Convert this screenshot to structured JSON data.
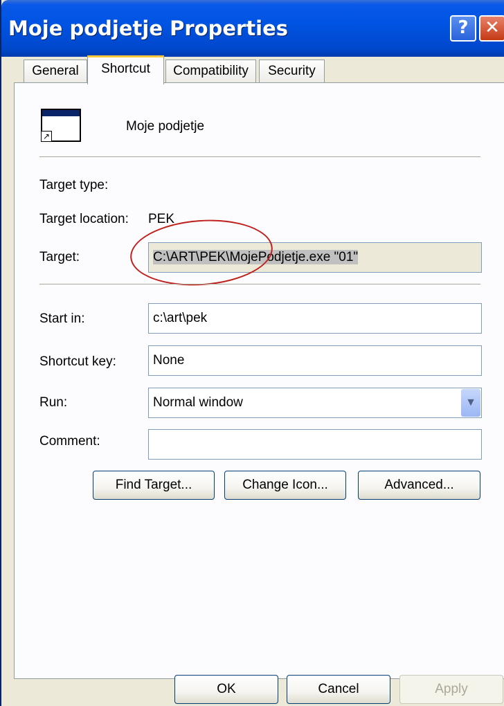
{
  "window": {
    "title": "Moje podjetje Properties",
    "help_glyph": "?",
    "close_glyph": "✕"
  },
  "tabs": [
    {
      "label": "General",
      "active": false
    },
    {
      "label": "Shortcut",
      "active": true
    },
    {
      "label": "Compatibility",
      "active": false
    },
    {
      "label": "Security",
      "active": false
    }
  ],
  "shortcut": {
    "name": "Moje podjetje",
    "target_type_label": "Target type:",
    "target_type_value": "",
    "target_location_label": "Target location:",
    "target_location_value": "PEK",
    "target_label": "Target:",
    "target_value": "C:\\ART\\PEK\\MojePodjetje.exe \"01\"",
    "start_in_label": "Start in:",
    "start_in_value": "c:\\art\\pek",
    "shortcut_key_label": "Shortcut key:",
    "shortcut_key_value": "None",
    "run_label": "Run:",
    "run_value": "Normal window",
    "comment_label": "Comment:",
    "comment_value": ""
  },
  "buttons": {
    "find_target": "Find Target...",
    "change_icon": "Change Icon...",
    "advanced": "Advanced...",
    "ok": "OK",
    "cancel": "Cancel",
    "apply": "Apply"
  },
  "colors": {
    "title_bar": "#0054e3",
    "active_tab_accent": "#ffc83c",
    "annotation_circle": "#c0201c"
  },
  "icons": {
    "app": "application-window-icon",
    "shortcut_overlay": "shortcut-arrow-icon",
    "dropdown": "chevron-down-icon"
  }
}
